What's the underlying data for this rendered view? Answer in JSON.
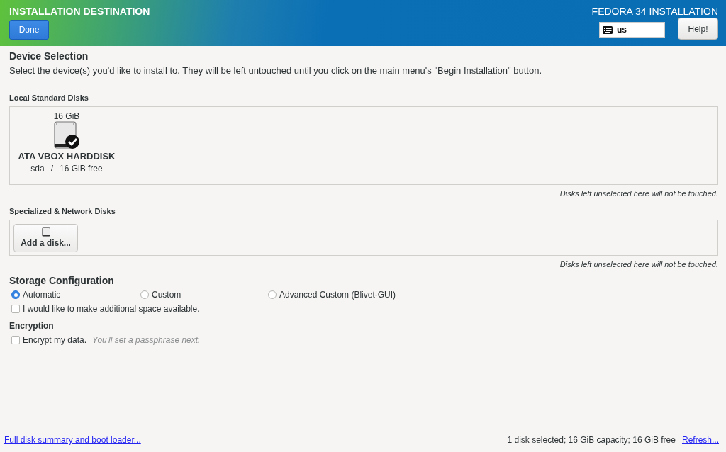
{
  "header": {
    "title": "INSTALLATION DESTINATION",
    "done_button": "Done",
    "product": "FEDORA 34 INSTALLATION",
    "keyboard_layout": "us",
    "help_button": "Help!"
  },
  "device_selection": {
    "heading": "Device Selection",
    "description": "Select the device(s) you'd like to install to.  They will be left untouched until you click on the main menu's \"Begin Installation\" button.",
    "local_disks": {
      "heading": "Local Standard Disks",
      "disks": [
        {
          "size": "16 GiB",
          "name": "ATA VBOX HARDDISK",
          "device": "sda",
          "separator": "/",
          "free": "16 GiB free",
          "selected": true
        }
      ],
      "note": "Disks left unselected here will not be touched."
    },
    "specialized_disks": {
      "heading": "Specialized & Network Disks",
      "add_button": "Add a disk...",
      "note": "Disks left unselected here will not be touched."
    }
  },
  "storage_configuration": {
    "heading": "Storage Configuration",
    "options": [
      {
        "label": "Automatic",
        "selected": true
      },
      {
        "label": "Custom",
        "selected": false
      },
      {
        "label": "Advanced Custom (Blivet-GUI)",
        "selected": false
      }
    ],
    "additional_space": {
      "label": "I would like to make additional space available.",
      "checked": false
    }
  },
  "encryption": {
    "heading": "Encryption",
    "encrypt": {
      "label": "Encrypt my data.",
      "hint": "You'll set a passphrase next.",
      "checked": false
    }
  },
  "footer": {
    "summary_link": "Full disk summary and boot loader...",
    "status": "1 disk selected; 16 GiB capacity; 16 GiB free",
    "refresh_link": "Refresh..."
  }
}
